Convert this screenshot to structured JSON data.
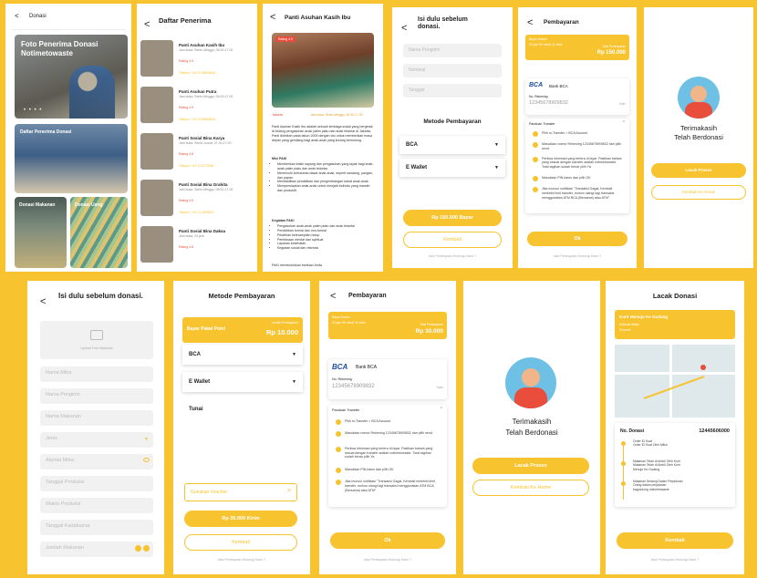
{
  "s1": {
    "back": "<",
    "title": "Donasi",
    "hero": "Foto Penerima Donasi Notimetowaste",
    "dots": "• • • •",
    "card1": "Daftar Penerima Donasi",
    "card2": "Donasi Makanan",
    "card3": "Donasi Uang"
  },
  "s2": {
    "title": "Daftar Penerima",
    "items": [
      {
        "name": "Panti Asuhan Kasih Ibu",
        "time": "Jam buka: Senin-Minggu, 06.00-17.00",
        "rating": "Rating 4.9",
        "phone": "Telepon: +62 21 58895616"
      },
      {
        "name": "Panti Asuhan Putra",
        "time": "Jam buka: Senin-Minggu, 06.00-17.00",
        "rating": "Rating 4.9",
        "phone": "Telepon: +62 21 58895616"
      },
      {
        "name": "Panti Sosial Bina Karya",
        "time": "Jam buka: Senin-Jumat, 07.00-17.00",
        "rating": "Rating 4.8",
        "phone": "Telepon: +62 21 5275356"
      },
      {
        "name": "Panti Sosial Bina Grahita",
        "time": "Jam buka: Senin-Minggu, 08.00-17.00",
        "rating": "Rating 4.9",
        "phone": "Telepon: +62 21 4609803"
      },
      {
        "name": "Panti Sosial Bina Daksa",
        "time": "Jam buka: 24 jam",
        "rating": "Rating 4.8",
        "phone": ""
      }
    ]
  },
  "s3": {
    "title": "Panti Asuhan Kasih Ibu",
    "rating": "Rating 4.9",
    "loc": "Jakarta",
    "hours": "Jam buka: Senin-Minggu, 06.00-17.00",
    "desc": "Panti Asuhan Kasih Ibu adalah sebuah lembaga sosial yang bergerak di bidang pengasuhan anak yatim piatu dan anak telantar di Jakarta. Panti didirikan pada tahun 2005 dengan visi untuk memberikan masa depan yang gemilang bagi anak-anak yang kurang beruntung.",
    "misi": "Misi PAKI",
    "misi_items": [
      "Memberikan kasih sayang dan pengasuhan yang layak bagi anak-anak yatim piatu dan anak telantar.",
      "Memenuhi kebutuhan dasar anak-anak, seperti sandang, pangan, dan papan.",
      "Memfasilitasi pendidikan dan pengembangan bakat anak-anak.",
      "Mempersiapkan anak-anak untuk menjadi individu yang mandiri dan produktif."
    ],
    "keg": "Kegiatan PAKI",
    "keg_items": [
      "Pengasuhan anak-anak yatim piatu dan anak telantar",
      "Pendidikan formal dan non-formal",
      "Pelatihan keterampilan hidup",
      "Pembinaan mental dan spiritual",
      "Layanan kesehatan",
      "Kegiatan sosial dan rekreasi"
    ],
    "foot": "PAKI membutuhkan bantuan Anda"
  },
  "s4": {
    "title": "Isi dulu sebelum donasi.",
    "f1": "Nama Pengirim",
    "f2": "Nominal",
    "f3": "Tanggal",
    "method": "Metode Pembayaran",
    "opt1": "BCA",
    "opt2": "E Wallet",
    "arrow": "▼",
    "pay": "Rp 150.000 Bayar",
    "back2": "Kembali",
    "help": "Ada Pertanyaan Hubungi Kami ?"
  },
  "s5": {
    "title": "Pembayaran",
    "lbl1": "Bayar Dalam",
    "lbl1b": "23 jam 59 menit 11 detik",
    "lbl2": "Total Pembayaran",
    "amount": "Rp 150.000",
    "bank_logo": "BCA",
    "bank": "Bank BCA",
    "norek_lbl": "No. Rekening",
    "norek": "12345678909832",
    "salin": "Salin",
    "pt": "Panduan Transfer",
    "steps": [
      "Pilih m-Transfer > BCA Account",
      "Masukkan nomor Rekening 12345678909832 dan pilih send.",
      "Periksa informasi yang tertera di layar. Pastikan bahwa yang sesuai dengan transfer adalah notimetowaste. Total tagihan sudah benar pilih Ya",
      "Masukkan PIN kamu dan pilih OK",
      "Jika muncul notifikasi \"Transaksi Gagal, Kembali melebihi limit transfer, mohon ulangi lagi transaksi menggunakan ATM BCA (Bersama) atau ATM\""
    ],
    "ok": "Ok",
    "help": "Ada Pertanyaan Hubungi Kami ?"
  },
  "s6": {
    "thanks1": "Terimakasih",
    "thanks2": "Telah Berdonasi",
    "btn1": "Lacak Proses",
    "btn2": "Kembali Ke Home"
  },
  "s7": {
    "title": "Isi dulu sebelum donasi.",
    "upload": "Upload Foto Makanan",
    "fields": [
      "Nama Mitra",
      "Nama Pengirim",
      "Nama Makanan",
      "Jenis",
      "Alamat Mitra",
      "Tanggal Produksi",
      "Waktu Produksi",
      "Tanggal Kadaluarsa",
      "Jumlah Makanan"
    ]
  },
  "s8": {
    "title": "Metode Pembayaran",
    "bayar": "Bayar Pakai Poin!",
    "poin_lbl": "Jumlah Pembayaran",
    "poin": "Rp 10.000",
    "opt1": "BCA",
    "opt2": "E Wallet",
    "opt3": "Tunai",
    "voucher": "Gunakan Voucher",
    "send": "Rp 30.000 Kirim",
    "back2": "Kembali",
    "help": "Ada Pertanyaan Hubungi Kami ?"
  },
  "s9": {
    "title": "Pembayaran",
    "lbl1": "Bayar Dalam",
    "lbl1b": "23 jam 59 menit 11 detik",
    "lbl2": "Total Pembayaran",
    "amount": "Rp 30.000",
    "bank_logo": "BCA",
    "bank": "Bank BCA",
    "norek_lbl": "No. Rekening",
    "norek": "12345678909832",
    "salin": "Salin",
    "pt": "Panduan Transfer",
    "steps": [
      "Pilih m-Transfer > BCA Account",
      "Masukkan nomor Rekening 12345678909832 dan pilih send.",
      "Periksa informasi yang tertera di layar. Pastikan bahwa yang sesuai dengan transfer adalah notimetowaste. Total tagihan sudah benar pilih Ya",
      "Masukkan PIN kamu dan pilih OK",
      "Jika muncul notifikasi \"Transaksi Gagal, Kembali melebihi limit transfer, mohon ulangi lagi transaksi menggunakan ATM BCA (Bersama) atau ATM\""
    ],
    "ok": "Ok",
    "help": "Ada Pertanyaan Hubungi Kami ?"
  },
  "s10": {
    "thanks1": "Terimakasih",
    "thanks2": "Telah Berdonasi",
    "btn1": "Lacak Proses",
    "btn2": "Kembali Ke Home"
  },
  "s11": {
    "title": "Lacak Donasi",
    "banner": "Kurir Menuju Ke Gudang",
    "banner2": "Estimasi Waktu",
    "banner3": "30 menit",
    "no_lbl": "No. Donasi",
    "no": "12445606000",
    "track": [
      "Order ID Kuat\nOrder ID Kuat Oleh Mitra",
      "Makanan Telah di Ambil Oleh Kurir\nMakanan Telah di Ambil Oleh Kurir\nMenuju Ke Gudang",
      "Makanan Sedang Dalam Perjalanan\nOrang dalam perjalanan\nbagusdong notimetowaste"
    ],
    "back2": "Kembali",
    "help": "Ada Pertanyaan Hubungi Kami ?"
  }
}
